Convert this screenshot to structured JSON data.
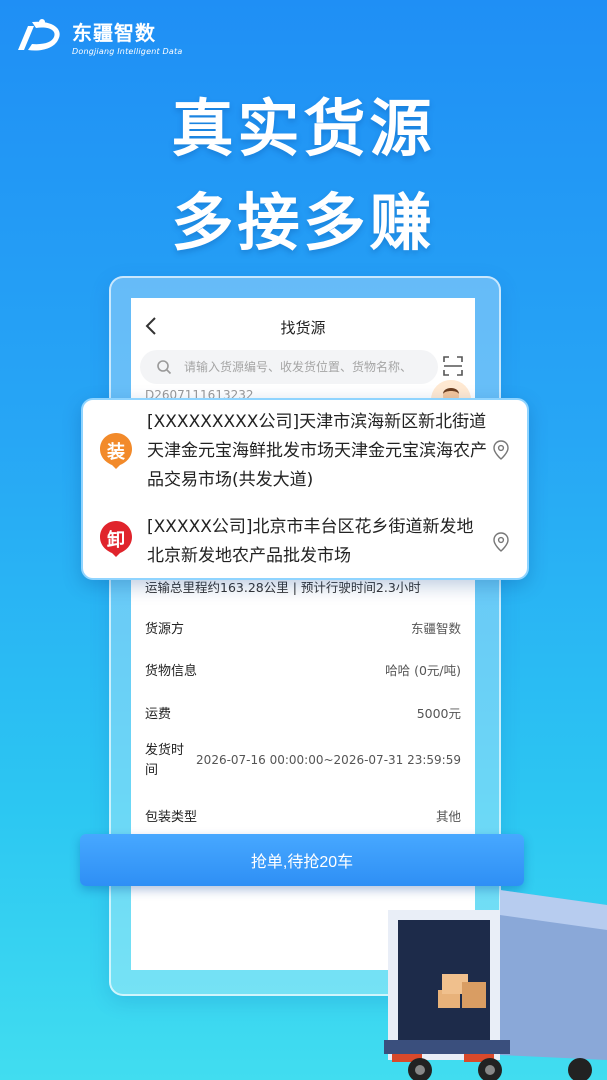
{
  "brand": {
    "name": "东疆智数",
    "subtitle": "Dongjiang Intelligent Data"
  },
  "headline": {
    "line1": "真实货源",
    "line2": "多接多赚"
  },
  "app": {
    "title": "找货源",
    "search_placeholder": "请输入货源编号、收发货位置、货物名称、",
    "order_no": "D2607111613232"
  },
  "route": {
    "load": {
      "badge": "装",
      "address": "[XXXXXXXXX公司]天津市滨海新区新北街道天津金元宝海鲜批发市场天津金元宝滨海农产品交易市场(共发大道)"
    },
    "unload": {
      "badge": "卸",
      "address": "[XXXXX公司]北京市丰台区花乡街道新发地北京新发地农产品批发市场"
    }
  },
  "distance_text": "运输总里程约163.28公里 | 预计行驶时间2.3小时",
  "details": [
    {
      "label": "货源方",
      "value": "东疆智数"
    },
    {
      "label": "货物信息",
      "value": "哈哈 (0元/吨)"
    },
    {
      "label": "运费",
      "value": "5000元"
    },
    {
      "label": "发货时间",
      "value": "2026-07-16 00:00:00~2026-07-31 23:59:59"
    },
    {
      "label": "包装类型",
      "value": "其他"
    }
  ],
  "grab_button": "抢单,待抢20车",
  "colors": {
    "load_badge": "#f28a2a",
    "unload_badge": "#e0242c",
    "accent": "#2e8ff5"
  },
  "icons": [
    "logo-icon",
    "back-icon",
    "search-icon",
    "scan-icon",
    "pin-icon",
    "avatar",
    "truck-illustration"
  ]
}
